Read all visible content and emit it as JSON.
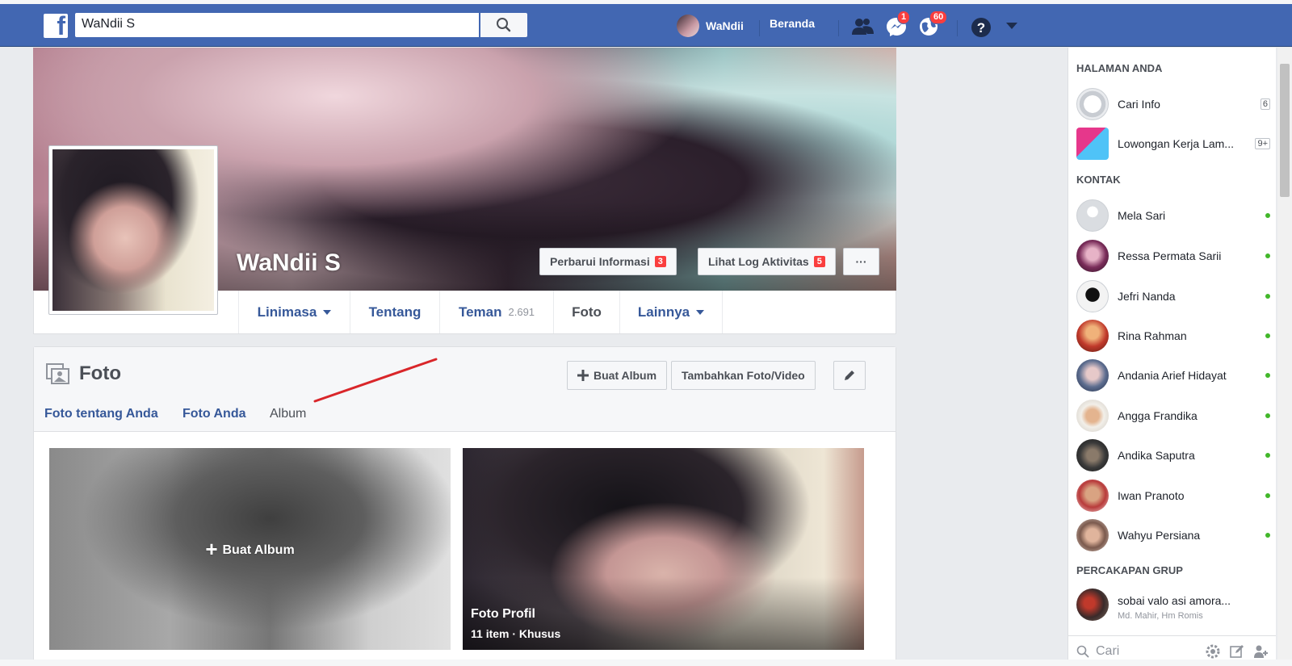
{
  "topbar": {
    "search_value": "WaNdii S",
    "user_name": "WaNdii",
    "home_label": "Beranda",
    "messages_badge": "1",
    "notifications_badge": "60",
    "brand_color": "#4267b2"
  },
  "profile": {
    "name": "WaNdii S",
    "update_info_label": "Perbarui Informasi",
    "update_info_count": "3",
    "activity_log_label": "Lihat Log Aktivitas",
    "activity_log_count": "5",
    "more_label": "···"
  },
  "tabs": [
    {
      "label": "Linimasa",
      "sub": ""
    },
    {
      "label": "Tentang",
      "sub": ""
    },
    {
      "label": "Teman",
      "sub": "2.691"
    },
    {
      "label": "Foto",
      "sub": ""
    },
    {
      "label": "Lainnya",
      "sub": ""
    }
  ],
  "photos": {
    "title": "Foto",
    "create_album_label": "Buat Album",
    "add_photo_label": "Tambahkan Foto/Video",
    "subtabs": [
      "Foto tentang Anda",
      "Foto Anda",
      "Album"
    ],
    "create_card_label": "Buat Album",
    "profile_album_title": "Foto Profil",
    "profile_album_meta": "11 item · Khusus"
  },
  "sidebar": {
    "pages_header": "HALAMAN ANDA",
    "pages": [
      {
        "name": "Cari Info",
        "count": "6"
      },
      {
        "name": "Lowongan Kerja Lam...",
        "count": "9+"
      }
    ],
    "contacts_header": "KONTAK",
    "contacts": [
      {
        "name": "Mela Sari"
      },
      {
        "name": "Ressa Permata Sarii"
      },
      {
        "name": "Jefri Nanda"
      },
      {
        "name": "Rina Rahman"
      },
      {
        "name": "Andania Arief Hidayat"
      },
      {
        "name": "Angga Frandika"
      },
      {
        "name": "Andika Saputra"
      },
      {
        "name": "Iwan Pranoto"
      },
      {
        "name": "Wahyu Persiana"
      }
    ],
    "groups_header": "PERCAKAPAN GRUP",
    "group": {
      "name": "sobai valo asi amora...",
      "members": "Md. Mahir, Hm Romis"
    },
    "search_placeholder": "Cari"
  }
}
